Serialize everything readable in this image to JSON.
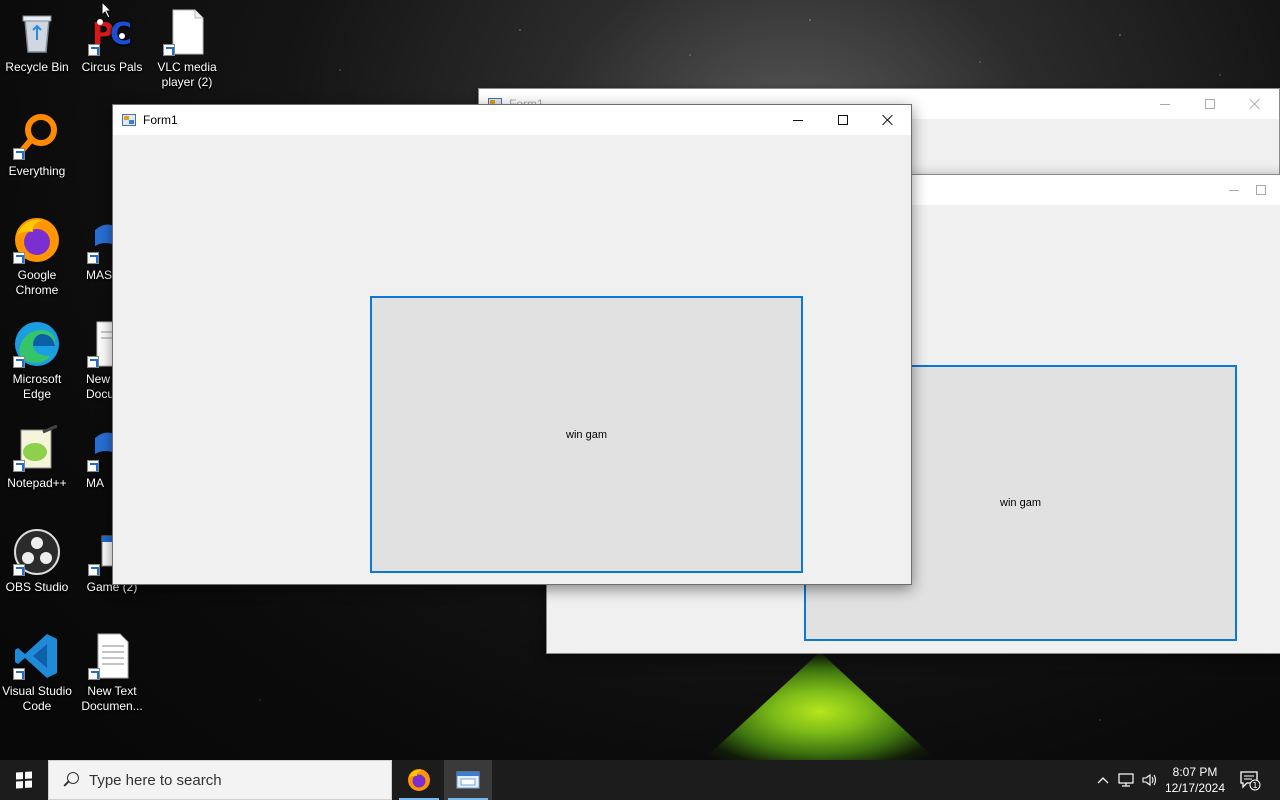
{
  "desktop": {
    "icons": [
      {
        "label": "Recycle Bin",
        "icon": "recycle-bin-icon"
      },
      {
        "label": "Circus Pals",
        "icon": "circus-pals-icon"
      },
      {
        "label": "VLC media player (2)",
        "icon": "document-icon"
      },
      {
        "label": "Everything",
        "icon": "everything-search-icon"
      },
      {
        "label": "Google Chrome",
        "icon": "firefox-icon"
      },
      {
        "label": "MAS",
        "icon": "mas-icon"
      },
      {
        "label": "Microsoft Edge",
        "icon": "edge-icon"
      },
      {
        "label": "New Docu",
        "icon": "document-icon"
      },
      {
        "label": "Notepad++",
        "icon": "notepadpp-icon"
      },
      {
        "label": "MA",
        "icon": "mas-icon"
      },
      {
        "label": "OBS Studio",
        "icon": "obs-icon"
      },
      {
        "label": "Game (2)",
        "icon": "game-icon"
      },
      {
        "label": "Visual Studio Code",
        "icon": "vscode-icon"
      },
      {
        "label": "New Text Documen...",
        "icon": "text-document-icon"
      }
    ]
  },
  "windows": {
    "active": {
      "title": "Form1",
      "button_label": "win gam"
    },
    "background_1": {
      "title": "Form1"
    },
    "background_2": {
      "button_label": "win gam"
    }
  },
  "taskbar": {
    "search_placeholder": "Type here to search",
    "time": "8:07 PM",
    "date": "12/17/2024",
    "notification_count": "1"
  },
  "colors": {
    "accent": "#0a78d7",
    "window_bg": "#f0f0f0",
    "button_bg": "#e1e1e1",
    "taskbar_bg": "#1c1c1c"
  }
}
